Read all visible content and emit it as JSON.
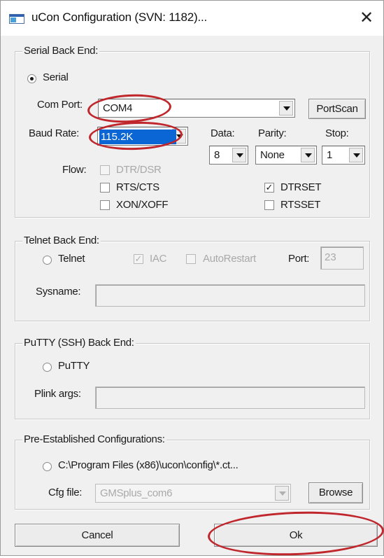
{
  "window": {
    "title": "uCon Configuration (SVN: 1182)...",
    "close_glyph": "✕"
  },
  "serial": {
    "group_title": "Serial Back End:",
    "radio_label": "Serial",
    "com_port_label": "Com Port:",
    "com_port_value": "COM4",
    "portscan_button": "PortScan",
    "baud_rate_label": "Baud Rate:",
    "baud_rate_value": "115.2K",
    "data_label": "Data:",
    "data_value": "8",
    "parity_label": "Parity:",
    "parity_value": "None",
    "stop_label": "Stop:",
    "stop_value": "1",
    "flow_label": "Flow:",
    "dtr_dsr_label": "DTR/DSR",
    "rts_cts_label": "RTS/CTS",
    "xon_xoff_label": "XON/XOFF",
    "dtrset_label": "DTRSET",
    "rtsset_label": "RTSSET",
    "dtrset_checked": true
  },
  "telnet": {
    "group_title": "Telnet Back End:",
    "radio_label": "Telnet",
    "iac_label": "IAC",
    "autorestart_label": "AutoRestart",
    "port_label": "Port:",
    "port_value": "23",
    "sysname_label": "Sysname:"
  },
  "putty": {
    "group_title": "PuTTY (SSH) Back End:",
    "radio_label": "PuTTY",
    "plink_label": "Plink args:"
  },
  "preconfig": {
    "group_title": "Pre-Established Configurations:",
    "path_label": "C:\\Program Files (x86)\\ucon\\config\\*.ct...",
    "cfg_label": "Cfg file:",
    "cfg_value": "GMSplus_com6",
    "browse_button": "Browse"
  },
  "footer": {
    "cancel_button": "Cancel",
    "ok_button": "Ok"
  },
  "icons": {
    "check_glyph": "✓",
    "app_icon": "window-app-icon"
  },
  "colors": {
    "annotation_ring": "#c0272d",
    "selection": "#0a66d4"
  }
}
